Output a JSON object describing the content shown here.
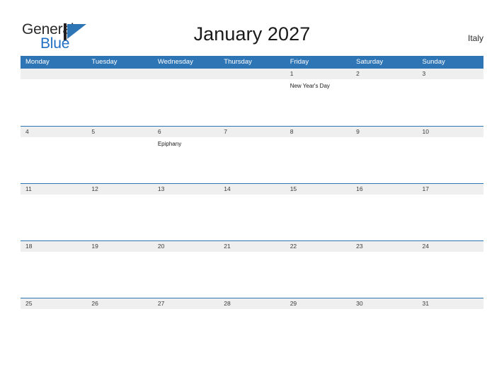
{
  "header": {
    "logo": {
      "line1": "General",
      "line2": "Blue",
      "triangle_color": "#2e75b6",
      "bar_color": "#231f20",
      "line2_color": "#1f6fc4"
    },
    "title": "January 2027",
    "country": "Italy"
  },
  "calendar": {
    "header_color": "#2e75b6",
    "date_band_color": "#efefef",
    "weekdays": [
      "Monday",
      "Tuesday",
      "Wednesday",
      "Thursday",
      "Friday",
      "Saturday",
      "Sunday"
    ],
    "weeks": [
      {
        "days": [
          {
            "date": "",
            "events": []
          },
          {
            "date": "",
            "events": []
          },
          {
            "date": "",
            "events": []
          },
          {
            "date": "",
            "events": []
          },
          {
            "date": "1",
            "events": [
              "New Year's Day"
            ]
          },
          {
            "date": "2",
            "events": []
          },
          {
            "date": "3",
            "events": []
          }
        ]
      },
      {
        "days": [
          {
            "date": "4",
            "events": []
          },
          {
            "date": "5",
            "events": []
          },
          {
            "date": "6",
            "events": [
              "Epiphany"
            ]
          },
          {
            "date": "7",
            "events": []
          },
          {
            "date": "8",
            "events": []
          },
          {
            "date": "9",
            "events": []
          },
          {
            "date": "10",
            "events": []
          }
        ]
      },
      {
        "days": [
          {
            "date": "11",
            "events": []
          },
          {
            "date": "12",
            "events": []
          },
          {
            "date": "13",
            "events": []
          },
          {
            "date": "14",
            "events": []
          },
          {
            "date": "15",
            "events": []
          },
          {
            "date": "16",
            "events": []
          },
          {
            "date": "17",
            "events": []
          }
        ]
      },
      {
        "days": [
          {
            "date": "18",
            "events": []
          },
          {
            "date": "19",
            "events": []
          },
          {
            "date": "20",
            "events": []
          },
          {
            "date": "21",
            "events": []
          },
          {
            "date": "22",
            "events": []
          },
          {
            "date": "23",
            "events": []
          },
          {
            "date": "24",
            "events": []
          }
        ]
      },
      {
        "days": [
          {
            "date": "25",
            "events": []
          },
          {
            "date": "26",
            "events": []
          },
          {
            "date": "27",
            "events": []
          },
          {
            "date": "28",
            "events": []
          },
          {
            "date": "29",
            "events": []
          },
          {
            "date": "30",
            "events": []
          },
          {
            "date": "31",
            "events": []
          }
        ]
      }
    ]
  }
}
